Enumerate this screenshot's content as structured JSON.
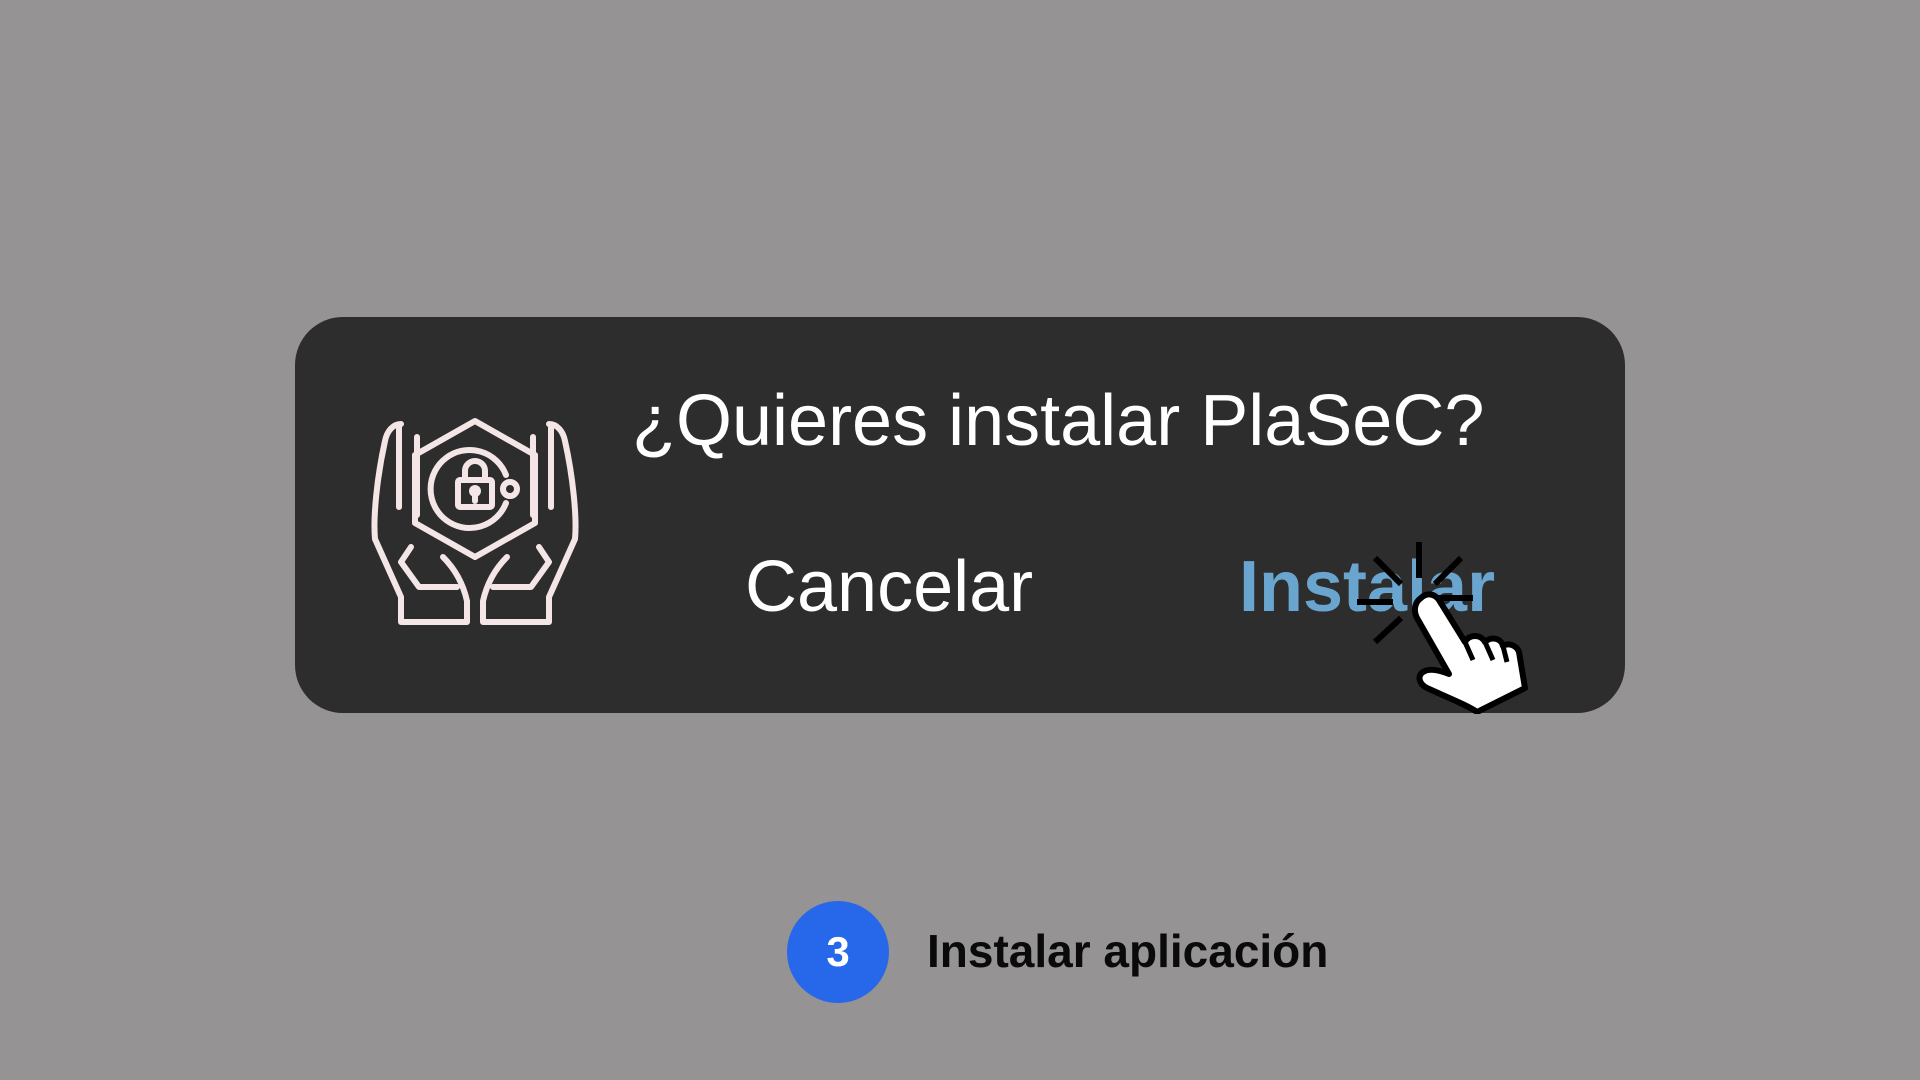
{
  "dialog": {
    "icon": "hands-holding-shield-lock-icon",
    "prompt": "¿Quieres instalar PlaSeC?",
    "cancel_label": "Cancelar",
    "install_label": "Instalar"
  },
  "pointer": {
    "icon": "hand-pointer-click-icon"
  },
  "step": {
    "number": "3",
    "label": "Instalar aplicación"
  },
  "colors": {
    "background": "#959394",
    "dialog_background": "#2d2d2d",
    "accent_install": "#6aa5d0",
    "step_badge": "#2767ea",
    "icon_stroke": "#f4e6e6"
  }
}
